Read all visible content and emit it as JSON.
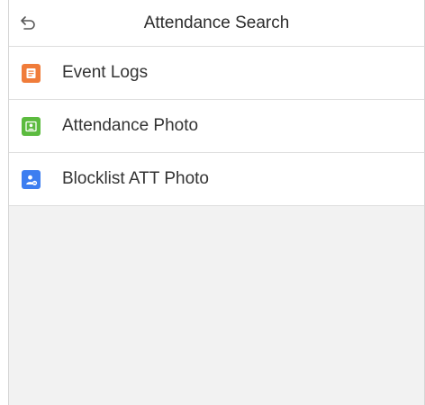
{
  "header": {
    "title": "Attendance Search",
    "back_icon": "back-arrow-icon"
  },
  "menu": {
    "items": [
      {
        "label": "Event Logs",
        "icon": "document-icon",
        "color": "#f07c3a"
      },
      {
        "label": "Attendance Photo",
        "icon": "photo-portrait-icon",
        "color": "#5cbb3f"
      },
      {
        "label": "Blocklist ATT Photo",
        "icon": "user-blocked-icon",
        "color": "#3d7ef0"
      }
    ]
  },
  "colors": {
    "background": "#f2f2f2",
    "surface": "#ffffff",
    "divider": "#dedede",
    "text": "#333333"
  }
}
